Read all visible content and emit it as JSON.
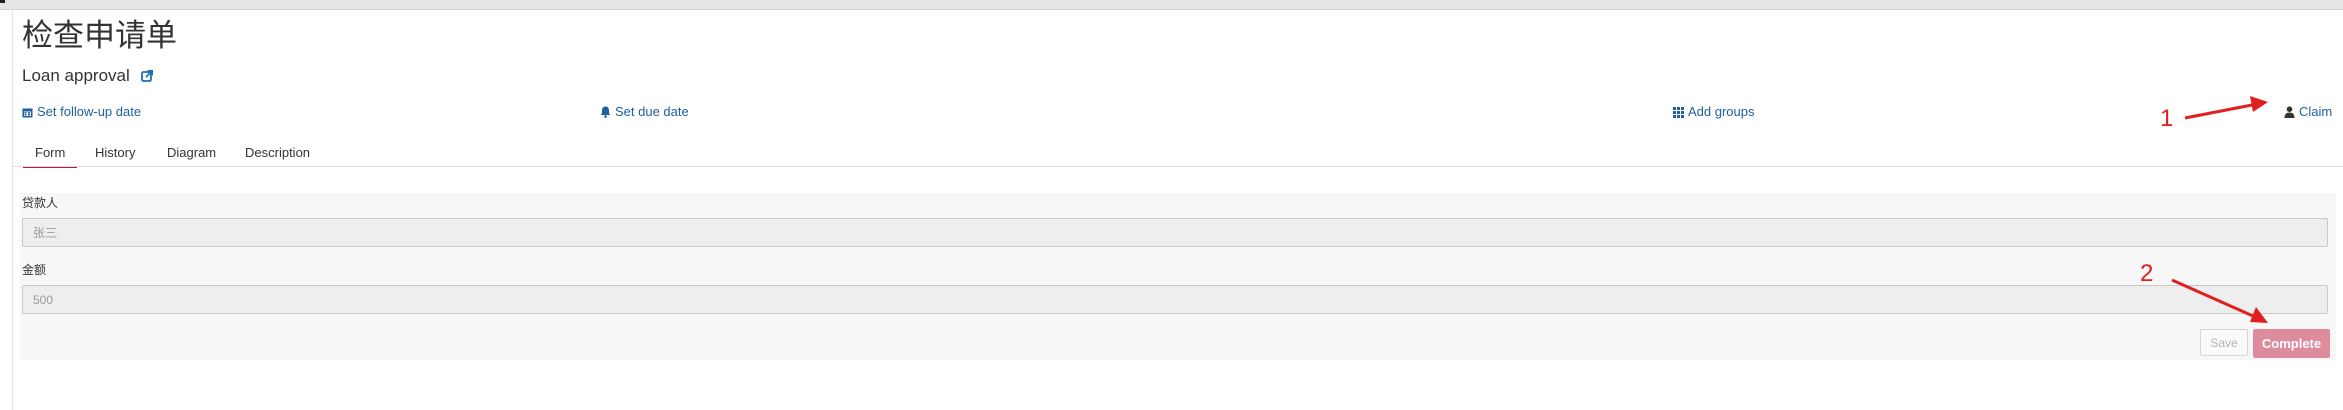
{
  "header": {
    "title": "检查申请单",
    "subtitle": "Loan approval"
  },
  "actions": {
    "follow_up": "Set follow-up date",
    "due_date": "Set due date",
    "add_groups": "Add groups",
    "claim": "Claim"
  },
  "tabs": [
    "Form",
    "History",
    "Diagram",
    "Description"
  ],
  "form": {
    "fields": [
      {
        "label": "贷款人",
        "value": "张三"
      },
      {
        "label": "金额",
        "value": "500"
      }
    ],
    "save_label": "Save",
    "complete_label": "Complete"
  },
  "annotations": {
    "one": "1",
    "two": "2"
  },
  "colors": {
    "link": "#1f5f9f",
    "tab_active_underline": "#c0153f",
    "complete_button": "#df8b9e",
    "annotation": "#e02020"
  }
}
